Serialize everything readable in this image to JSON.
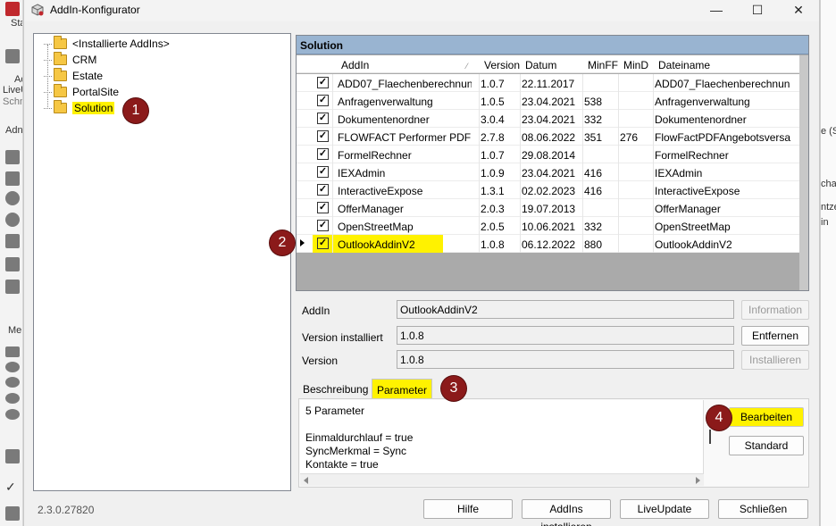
{
  "background_app": {
    "left_texts": [
      "Sta",
      "Ad",
      "LiveU",
      "Schn",
      "Adn",
      "Me"
    ],
    "right_texts": [
      "e (St",
      "cha",
      "ntze",
      "in"
    ]
  },
  "window": {
    "title": "AddIn-Konfigurator",
    "minimize_glyph": "—",
    "maximize_glyph": "☐",
    "close_glyph": "✕"
  },
  "tree": {
    "items": [
      {
        "label": "<Installierte AddIns>"
      },
      {
        "label": "CRM"
      },
      {
        "label": "Estate"
      },
      {
        "label": "PortalSite"
      },
      {
        "label": "Solution"
      }
    ],
    "selected_index": 4
  },
  "grid": {
    "header": "Solution",
    "columns": [
      "AddIn",
      "Version",
      "Datum",
      "MinFF",
      "MinD",
      "Dateiname"
    ],
    "sort_indicator": "⁄",
    "rows": [
      {
        "checked": "✓",
        "addin": "ADD07_Flaechenberechnun",
        "version": "1.0.7",
        "datum": "22.11.2017",
        "minff": "",
        "mind": "",
        "dateiname": "ADD07_Flaechenberechnun"
      },
      {
        "checked": "✓",
        "addin": "Anfragenverwaltung",
        "version": "1.0.5",
        "datum": "23.04.2021",
        "minff": "538",
        "mind": "",
        "dateiname": "Anfragenverwaltung"
      },
      {
        "checked": "✓",
        "addin": "Dokumentenordner",
        "version": "3.0.4",
        "datum": "23.04.2021",
        "minff": "332",
        "mind": "",
        "dateiname": "Dokumentenordner"
      },
      {
        "checked": "✓",
        "addin": "FLOWFACT Performer PDF A",
        "version": "2.7.8",
        "datum": "08.06.2022",
        "minff": "351",
        "mind": "276",
        "dateiname": "FlowFactPDFAngebotsversa"
      },
      {
        "checked": "✓",
        "addin": "FormelRechner",
        "version": "1.0.7",
        "datum": "29.08.2014",
        "minff": "",
        "mind": "",
        "dateiname": "FormelRechner"
      },
      {
        "checked": "✓",
        "addin": "IEXAdmin",
        "version": "1.0.9",
        "datum": "23.04.2021",
        "minff": "416",
        "mind": "",
        "dateiname": "IEXAdmin"
      },
      {
        "checked": "✓",
        "addin": "InteractiveExpose",
        "version": "1.3.1",
        "datum": "02.02.2023",
        "minff": "416",
        "mind": "",
        "dateiname": "InteractiveExpose"
      },
      {
        "checked": "✓",
        "addin": "OfferManager",
        "version": "2.0.3",
        "datum": "19.07.2013",
        "minff": "",
        "mind": "",
        "dateiname": "OfferManager"
      },
      {
        "checked": "✓",
        "addin": "OpenStreetMap",
        "version": "2.0.5",
        "datum": "10.06.2021",
        "minff": "332",
        "mind": "",
        "dateiname": "OpenStreetMap"
      },
      {
        "checked": "✓",
        "addin": "OutlookAddinV2",
        "version": "1.0.8",
        "datum": "06.12.2022",
        "minff": "880",
        "mind": "",
        "dateiname": "OutlookAddinV2"
      }
    ],
    "selected_index": 9
  },
  "details": {
    "addin_label": "AddIn",
    "addin_value": "OutlookAddinV2",
    "installed_label": "Version installiert",
    "installed_value": "1.0.8",
    "version_label": "Version",
    "version_value": "1.0.8",
    "information_button": "Information",
    "remove_button": "Entfernen",
    "install_button": "Installieren"
  },
  "tabs": {
    "description": "Beschreibung",
    "parameters": "Parameter"
  },
  "parameter_panel": {
    "text": "5 Parameter\n\nEinmaldurchlauf = true\nSyncMerkmal = Sync\nKontakte = true",
    "edit_button": "Bearbeiten",
    "default_button": "Standard"
  },
  "footer": {
    "version": "2.3.0.27820",
    "help_button": "Hilfe",
    "install_addins_button": "AddIns installieren",
    "liveupdate_button": "LiveUpdate",
    "close_button": "Schließen"
  },
  "callouts": [
    "1",
    "2",
    "3",
    "4"
  ],
  "colors": {
    "highlight": "#fff200",
    "grid_header": "#99b4d1",
    "callout": "#8b1a1a"
  }
}
